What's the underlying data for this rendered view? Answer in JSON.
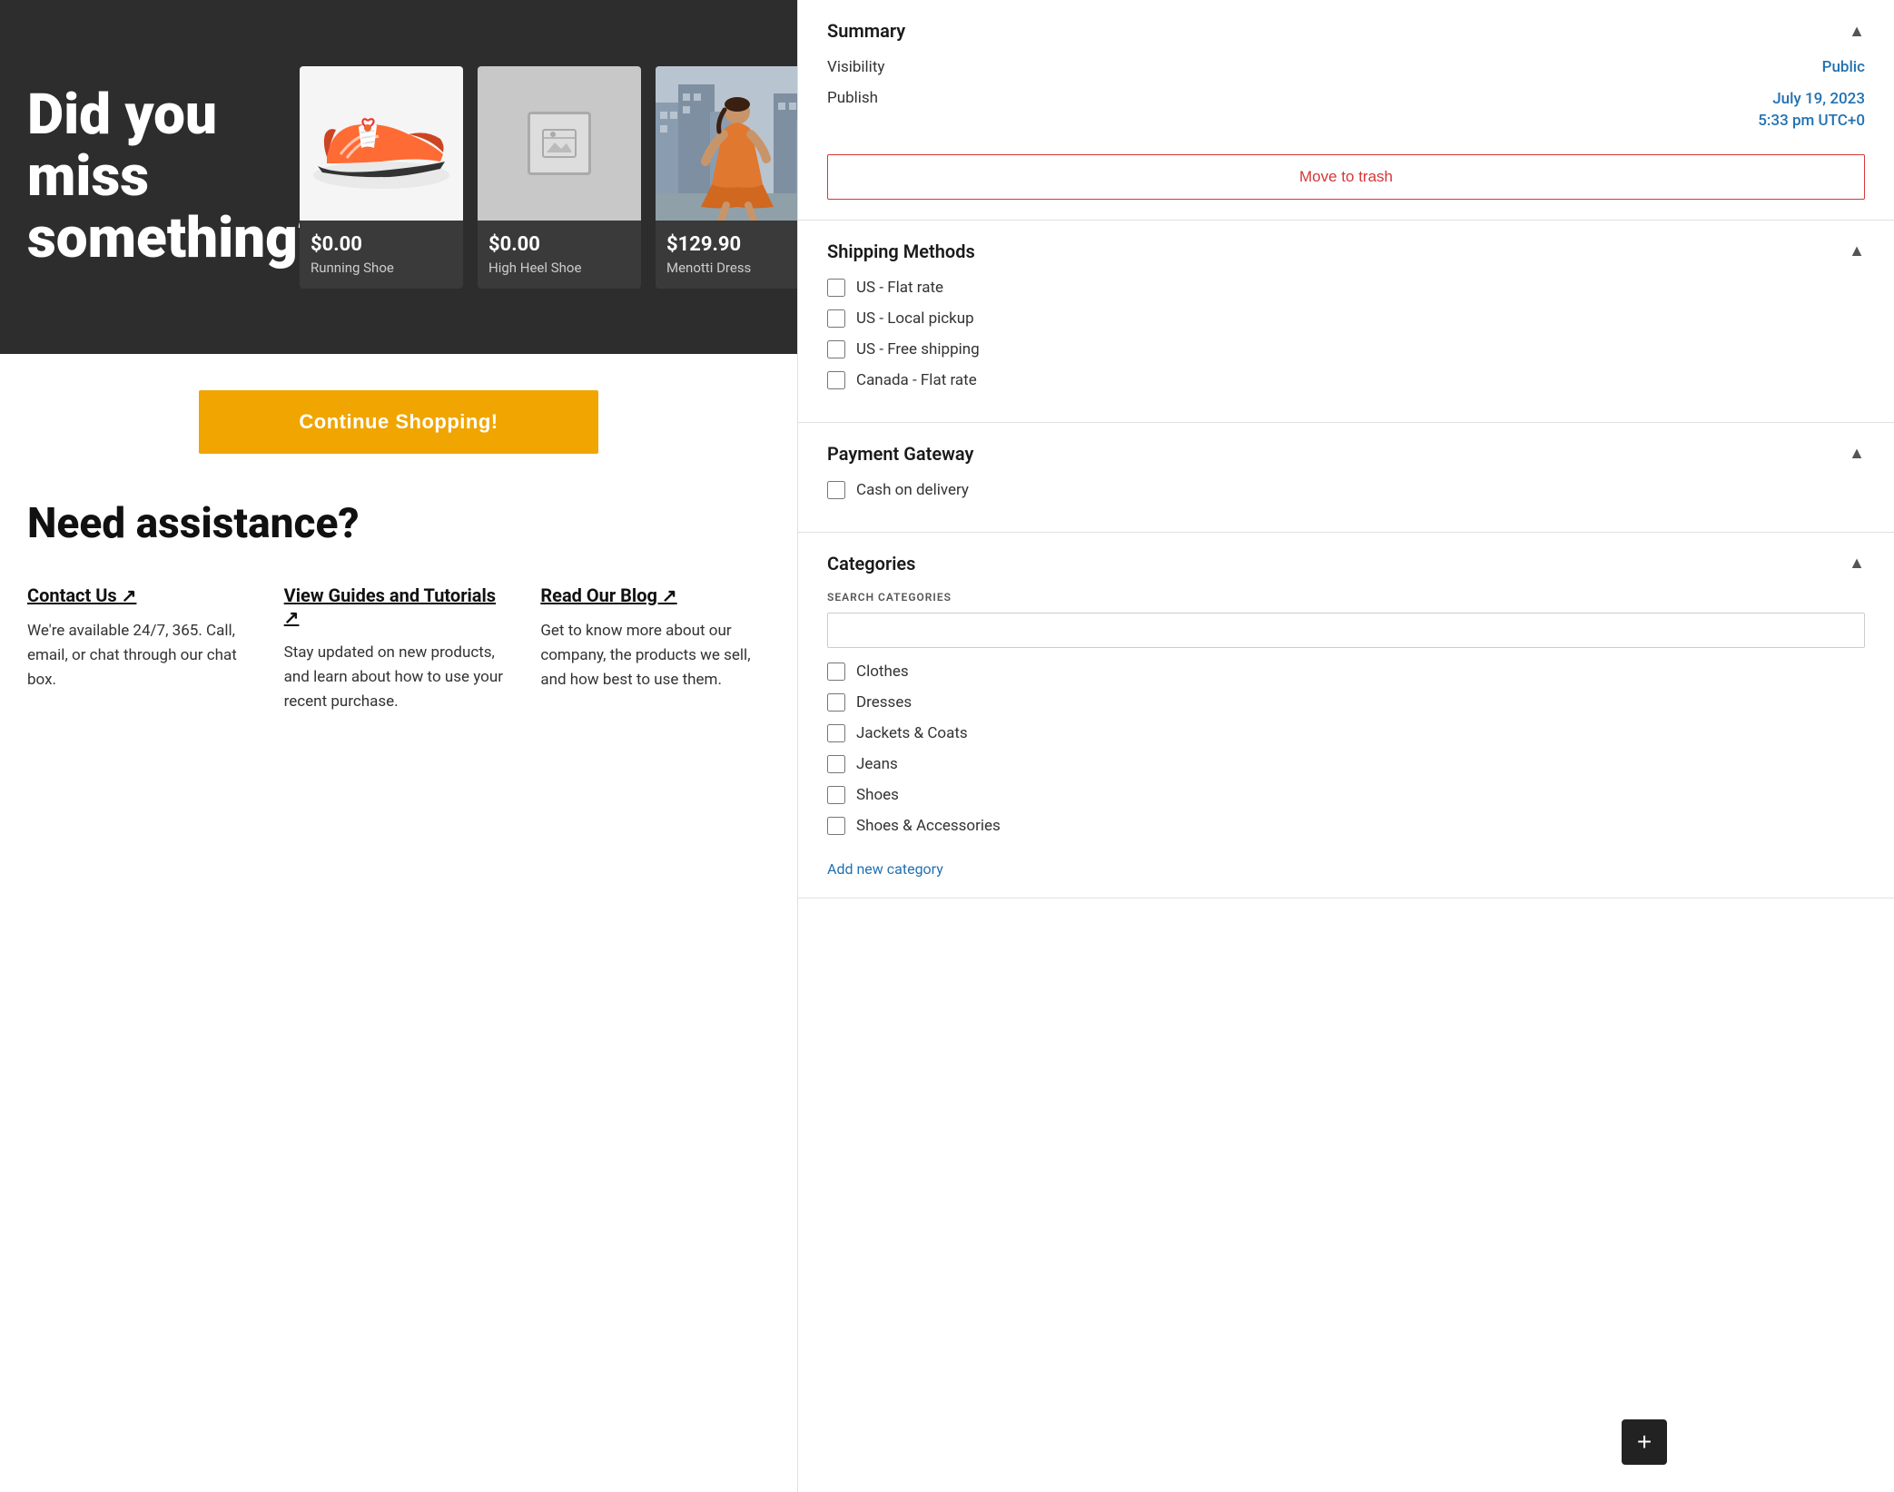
{
  "hero": {
    "title": "Did you miss something?",
    "products": [
      {
        "price": "$0.00",
        "name": "Running Shoe",
        "imageType": "shoe"
      },
      {
        "price": "$0.00",
        "name": "High Heel Shoe",
        "imageType": "placeholder"
      },
      {
        "price": "$129.90",
        "name": "Menotti Dress",
        "imageType": "dress"
      }
    ],
    "continue_button": "Continue Shopping!"
  },
  "assistance": {
    "title": "Need assistance?",
    "items": [
      {
        "link": "Contact Us ↗",
        "description": "We're available 24/7, 365. Call, email, or chat through our chat box."
      },
      {
        "link": "View Guides and Tutorials ↗",
        "description": "Stay updated on new products, and learn about how to use your recent purchase."
      },
      {
        "link": "Read Our Blog ↗",
        "description": "Get to know more about our company, the products we sell, and how best to use them."
      }
    ]
  },
  "sidebar": {
    "summary": {
      "title": "Summary",
      "visibility_label": "Visibility",
      "visibility_value": "Public",
      "publish_label": "Publish",
      "publish_date": "July 19, 2023",
      "publish_time": "5:33 pm UTC+0",
      "move_to_trash": "Move to trash"
    },
    "shipping_methods": {
      "title": "Shipping Methods",
      "options": [
        {
          "label": "US - Flat rate",
          "checked": false
        },
        {
          "label": "US - Local pickup",
          "checked": false
        },
        {
          "label": "US - Free shipping",
          "checked": false
        },
        {
          "label": "Canada - Flat rate",
          "checked": false
        }
      ]
    },
    "payment_gateway": {
      "title": "Payment Gateway",
      "options": [
        {
          "label": "Cash on delivery",
          "checked": false
        }
      ]
    },
    "categories": {
      "title": "Categories",
      "search_label": "SEARCH CATEGORIES",
      "search_placeholder": "",
      "items": [
        {
          "label": "Clothes",
          "checked": false
        },
        {
          "label": "Dresses",
          "checked": false
        },
        {
          "label": "Jackets & Coats",
          "checked": false
        },
        {
          "label": "Jeans",
          "checked": false
        },
        {
          "label": "Shoes",
          "checked": false
        },
        {
          "label": "Shoes & Accessories",
          "checked": false
        }
      ],
      "add_link": "Add new category"
    }
  },
  "add_button_label": "+"
}
